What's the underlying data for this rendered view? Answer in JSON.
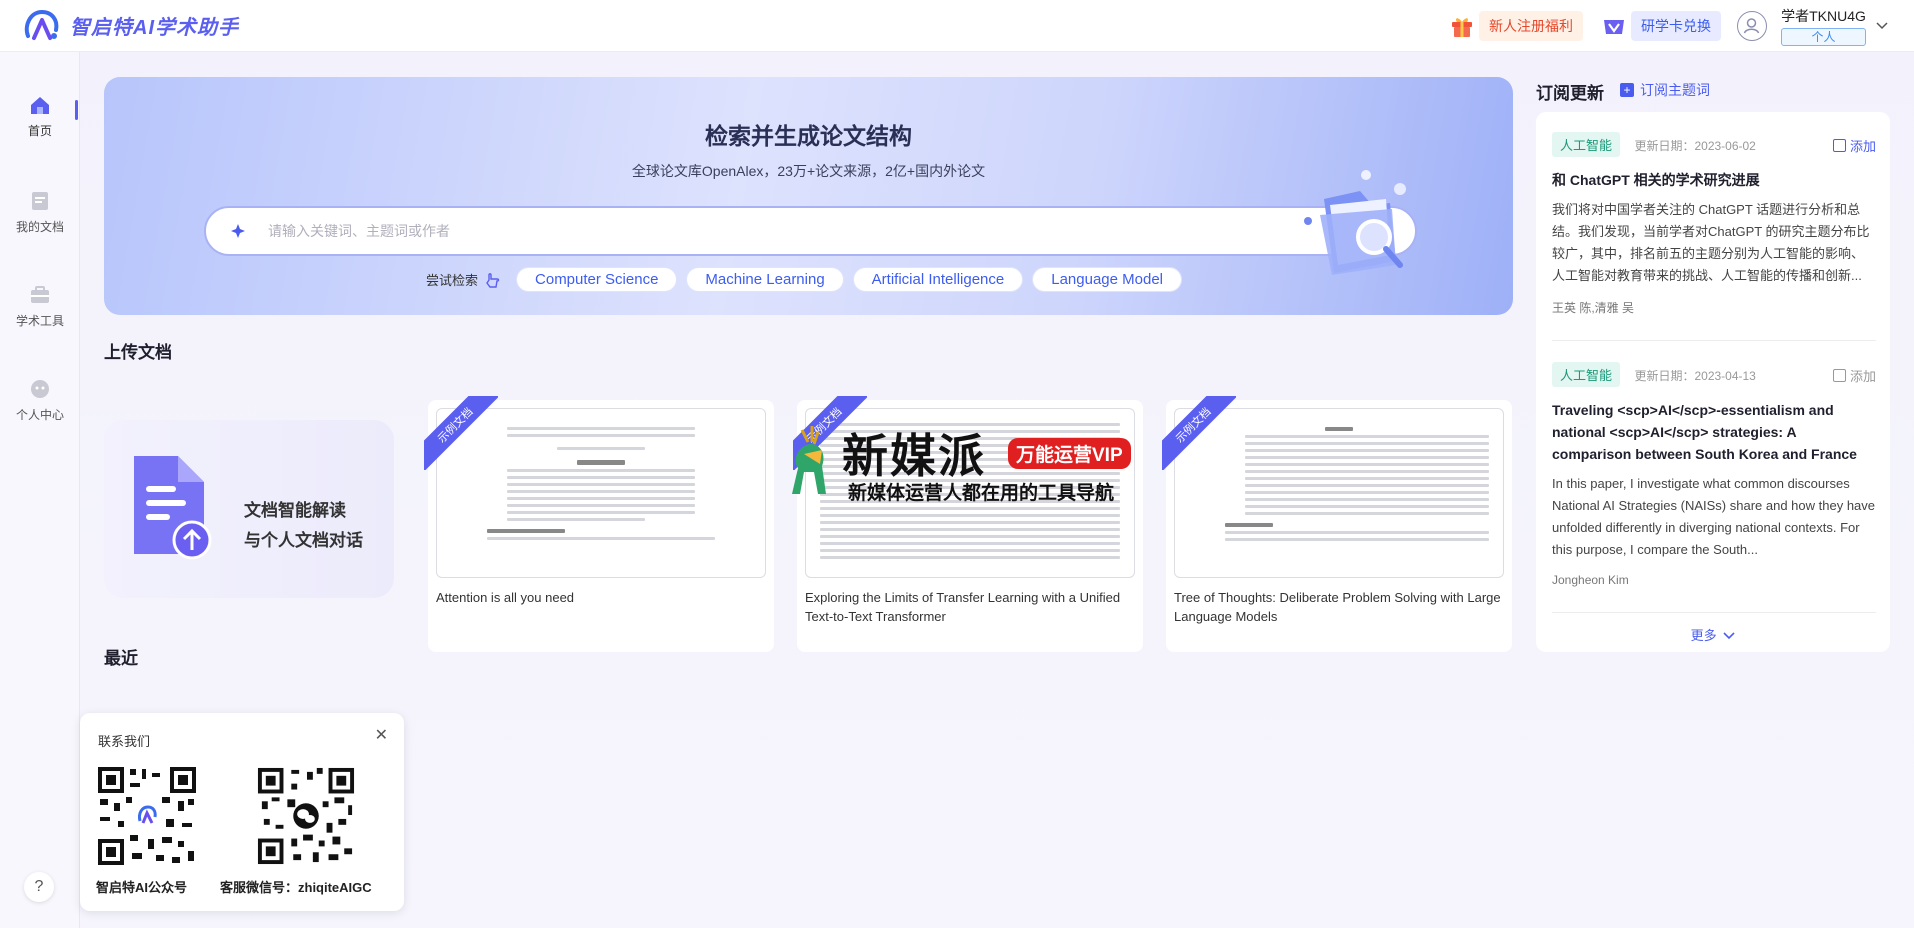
{
  "header": {
    "app_title": "智启特AI学术助手",
    "promo_label": "新人注册福利",
    "card_label": "研学卡兑换",
    "user_name": "学者TKNU4G",
    "user_tag": "个人"
  },
  "sidebar": {
    "items": [
      {
        "label": "首页",
        "icon": "home-icon"
      },
      {
        "label": "我的文档",
        "icon": "document-icon"
      },
      {
        "label": "学术工具",
        "icon": "toolbox-icon"
      },
      {
        "label": "个人中心",
        "icon": "user-icon"
      }
    ],
    "help": "?"
  },
  "hero": {
    "title": "检索并生成论文结构",
    "subtitle": "全球论文库OpenAlex，23万+论文来源，2亿+国内外论文",
    "search_placeholder": "请输入关键词、主题词或作者",
    "try_label": "尝试检索",
    "chips": [
      "Computer Science",
      "Machine Learning",
      "Artificial Intelligence",
      "Language Model"
    ]
  },
  "upload": {
    "section_title": "上传文档",
    "line1": "文档智能解读",
    "line2": "与个人文档对话"
  },
  "docs": {
    "ribbon": "示例文档",
    "items": [
      {
        "title": "Attention is all you need"
      },
      {
        "title": "Exploring the Limits of Transfer Learning with a Unified Text-to-Text Transformer"
      },
      {
        "title": "Tree of Thoughts: Deliberate Problem Solving with Large Language Models"
      }
    ],
    "watermark_main": "新媒派",
    "watermark_vip": "万能运营VIP",
    "watermark_sub": "新媒体运营人都在用的工具导航"
  },
  "recent": {
    "section_title": "最近"
  },
  "contact": {
    "title": "联系我们",
    "close": "✕",
    "qr1_caption": "智启特AI公众号",
    "qr2_caption": "客服微信号：zhiqiteAIGC"
  },
  "subscriptions": {
    "title": "订阅更新",
    "link": "订阅主题词",
    "add_label": "添加",
    "more": "更多",
    "articles": [
      {
        "tag": "人工智能",
        "date": "更新日期：2023-06-02",
        "title": "和 ChatGPT 相关的学术研究进展",
        "body": "我们将对中国学者关注的 ChatGPT 话题进行分析和总结。我们发现，当前学者对ChatGPT 的研究主题分布比较广，其中，排名前五的主题分别为人工智能的影响、人工智能对教育带来的挑战、人工智能的传播和创新...",
        "authors": "王英 陈,清雅 吴"
      },
      {
        "tag": "人工智能",
        "date": "更新日期：2023-04-13",
        "title": "Traveling <scp>AI</scp>-essentialism and national <scp>AI</scp> strategies: A comparison between South Korea and France",
        "body": "In this paper, I investigate what common discourses National AI Strategies (NAISs) share and how they have unfolded differently in diverging national contexts. For this purpose, I compare the South...",
        "authors": "Jongheon Kim"
      }
    ]
  },
  "colors": {
    "accent": "#5b5ff0",
    "link": "#4a5cf0",
    "tag_green": "#1a9a7a"
  }
}
